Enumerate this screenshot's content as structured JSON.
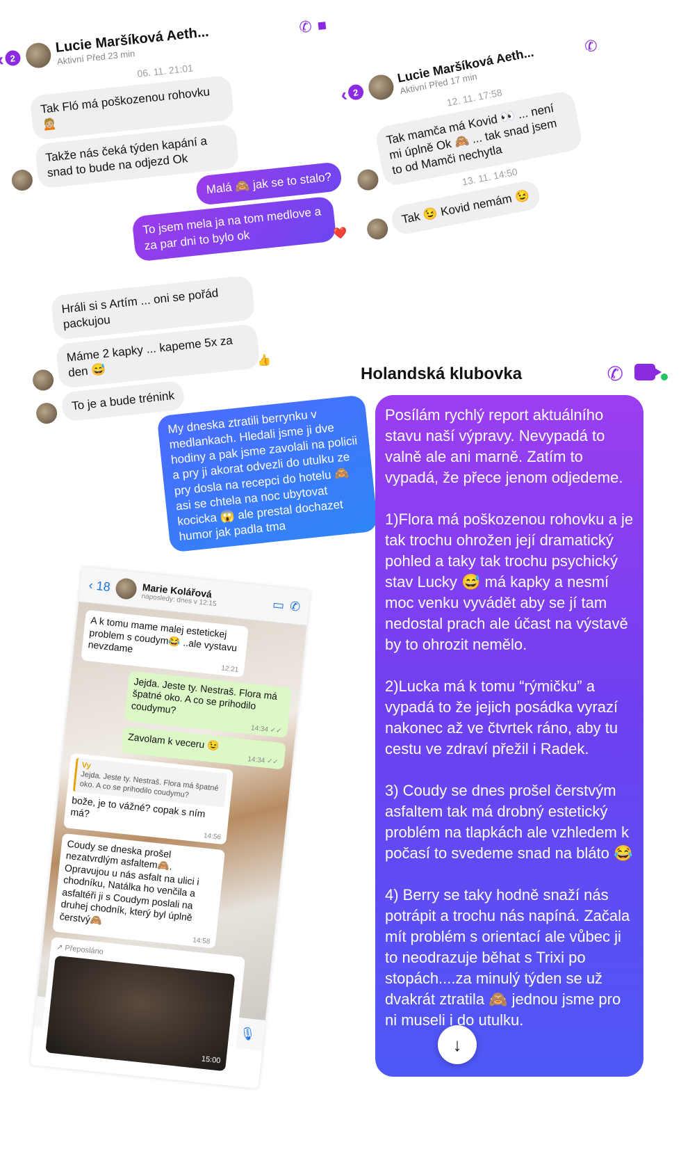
{
  "panel_top_left": {
    "back_count": "2",
    "name": "Lucie Maršíková Aeth...",
    "status": "Aktivní Před 23 min",
    "timestamp": "06. 11. 21:01",
    "messages": [
      {
        "dir": "in",
        "text": "Tak Fló má poškozenou rohovku 🙍🏼"
      },
      {
        "dir": "in",
        "text": "Takže nás čeká týden kapání a snad to bude na odjezd Ok"
      },
      {
        "dir": "out",
        "text": "Malá 🙈 jak se to stalo?"
      },
      {
        "dir": "out",
        "text": "To jsem mela ja na tom medlove a za par dni to bylo ok",
        "reaction": "❤️"
      },
      {
        "dir": "in",
        "text": "Hráli si s Artím ... oni se pořád packujou"
      },
      {
        "dir": "in",
        "text": "Máme 2 kapky ... kapeme 5x za den 😅",
        "reaction": "👍"
      },
      {
        "dir": "in",
        "text": "To je a bude trénink"
      },
      {
        "dir": "out_blue",
        "text": "My dneska ztratili berrynku v medlankach. Hledali jsme ji dve hodiny a pak jsme zavolali na policii a pry ji akorat odvezli do utulku ze pry dosla na recepci do hotelu 🙈 asi se chtela na noc ubytovat kocicka 😱 ale prestal dochazet humor jak padla tma"
      }
    ]
  },
  "panel_top_right": {
    "back_count": "2",
    "name": "Lucie Maršíková Aeth...",
    "status": "Aktivní Před 17 min",
    "timestamp1": "12. 11. 17:58",
    "msg1": "Tak mamča má Kovid 👀 ... není mi úplně Ok 🙈 ... tak snad jsem to od Mamči nechytla",
    "timestamp2": "13. 11. 14:50",
    "msg2": "Tak 😉 Kovid nemám 😉"
  },
  "panel_right": {
    "title": "Holandská klubovka",
    "paragraphs": [
      "Posílám rychlý report aktuálního stavu naší výpravy. Nevypadá to valně ale ani marně. Zatím to vypadá, že přece jenom odjedeme.",
      "1)Flora má poškozenou rohovku a je tak trochu ohrožen její dramatický pohled a taky tak trochu psychický stav Lucky 😅 má kapky a nesmí moc venku vyvádět aby se jí tam nedostal prach ale účast na výstavě by to ohrozit nemělo.",
      "2)Lucka má k tomu “rýmičku” a vypadá to že jejich posádka vyrazí nakonec až ve čtvrtek ráno, aby tu cestu ve zdraví přežil i Radek.",
      "3) Coudy se dnes prošel čerstvým asfaltem tak má drobný estetický problém na tlapkách ale vzhledem k počasí to svedeme snad na bláto 😂",
      "4) Berry se taky hodně snaží nás potrápit a trochu nás napíná. Začala mít problém s orientací ale vůbec ji to neodrazuje běhat s Trixi po stopách....za minulý týden se už dvakrát ztratila 🙈 jednou jsme pro ni museli i do utulku."
    ],
    "scroll_icon": "↓"
  },
  "panel_whatsapp": {
    "back_count": "18",
    "name": "Marie Kolářová",
    "status": "naposledy: dnes v 12:15",
    "messages": [
      {
        "dir": "in",
        "text": "A k tomu mame malej estetickej problem s coudym😂 ..ale vystavu nevzdame",
        "time": "12:21"
      },
      {
        "dir": "out",
        "text": "Jejda. Jeste ty. Nestraš. Flora má špatné oko. A co se prihodilo coudymu?",
        "time": "14:34 ✓✓"
      },
      {
        "dir": "out",
        "text": "Zavolam k veceru 😉",
        "time": "14:34 ✓✓"
      }
    ],
    "quote_author": "Vy",
    "quote_text": "Jejda. Jeste ty. Nestraš. Flora má špatné oko. A co se prihodilo coudymu?",
    "quote_reply": "bože, je to vážné? copak s ním má?",
    "quote_time": "14:56",
    "long_msg": "Coudy se dneska prošel nezatvrdlým asfaltem🙈. Opravujou u nás asfalt na ulici i chodníku, Natálka ho venčila a asfaltéři ji s Coudym poslali na druhej chodník, který byl úplně čerstvý🙈",
    "long_time": "14:58",
    "forwarded": "↗ Přeposláno",
    "image_time": "15:00"
  }
}
